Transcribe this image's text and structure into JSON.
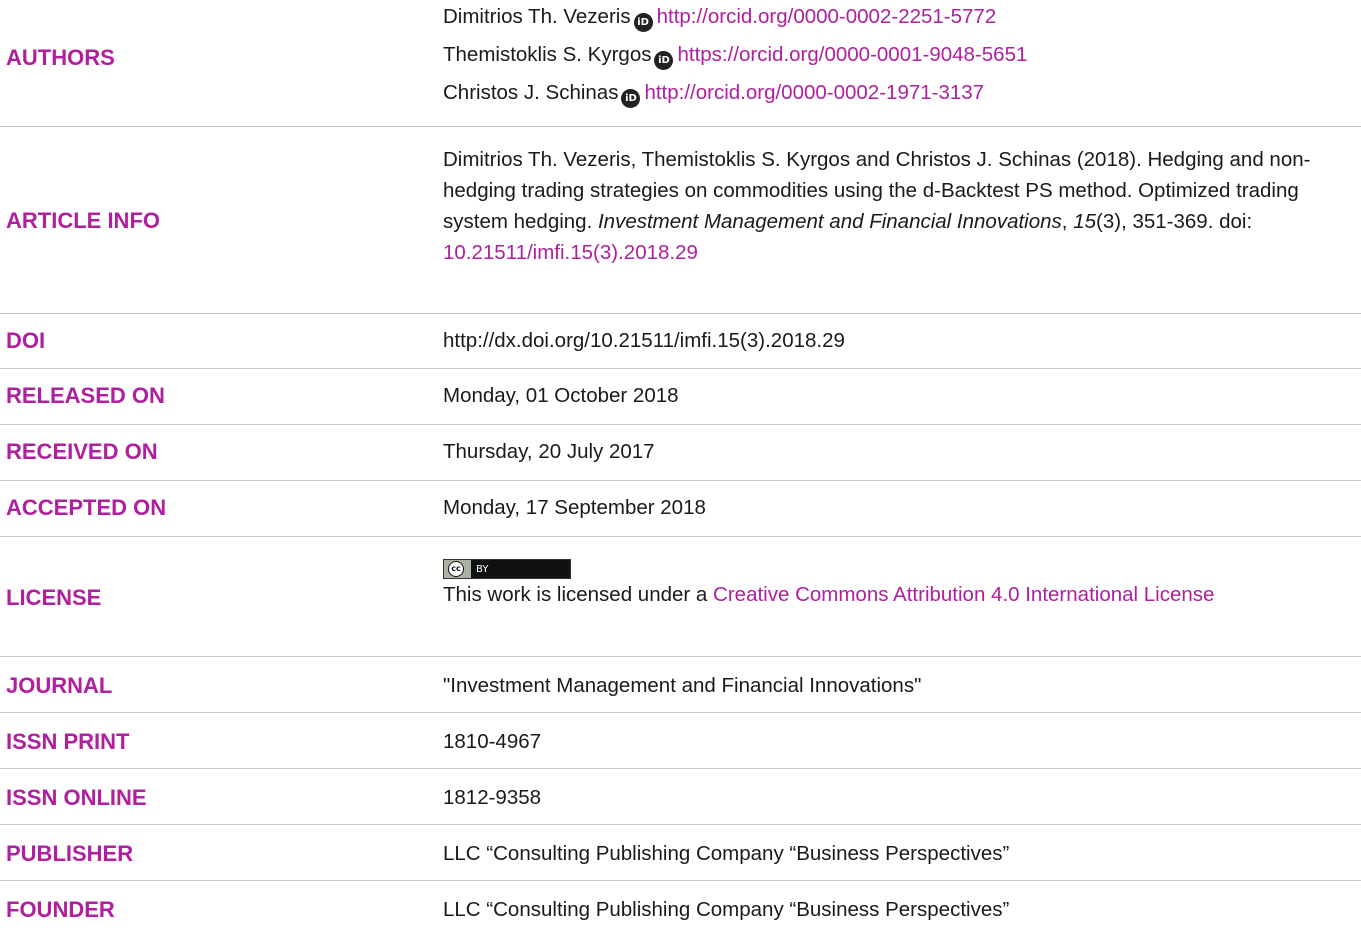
{
  "authors": {
    "label": "AUTHORS",
    "list": [
      {
        "name": "Dimitrios Th. Vezeris",
        "orcid_url": "http://orcid.org/0000-0002-2251-5772"
      },
      {
        "name": "Themistoklis S. Kyrgos",
        "orcid_url": "https://orcid.org/0000-0001-9048-5651"
      },
      {
        "name": "Christos J. Schinas",
        "orcid_url": "http://orcid.org/0000-0002-1971-3137"
      }
    ]
  },
  "article_info": {
    "label": "ARTICLE INFO",
    "citation_authors": "Dimitrios Th. Vezeris, Themistoklis S. Kyrgos and Christos J. Schinas (2018). Hedging and non-hedging trading strategies on commodities using the d-Backtest PS method. Optimized trading system hedging. ",
    "journal_italic": "Investment Management and Financial Innovations",
    "sep1": ", ",
    "volume_italic": "15",
    "issue_pages": "(3), 351-369. doi:",
    "doi_link": "10.21511/imfi.15(3).2018.29"
  },
  "doi": {
    "label": "DOI",
    "value": "http://dx.doi.org/10.21511/imfi.15(3).2018.29"
  },
  "released_on": {
    "label": "RELEASED ON",
    "value": "Monday, 01 October 2018"
  },
  "received_on": {
    "label": "RECEIVED ON",
    "value": "Thursday, 20 July 2017"
  },
  "accepted_on": {
    "label": "ACCEPTED ON",
    "value": "Monday, 17 September 2018"
  },
  "license": {
    "label": "LICENSE",
    "badge_left": "cc",
    "badge_right": "BY",
    "text_prefix": "This work is licensed under a ",
    "link_text": "Creative Commons Attribution 4.0 International License"
  },
  "journal": {
    "label": "JOURNAL",
    "value": "\"Investment Management and Financial Innovations\""
  },
  "issn_print": {
    "label": "ISSN PRINT",
    "value": "1810-4967"
  },
  "issn_online": {
    "label": "ISSN ONLINE",
    "value": "1812-9358"
  },
  "publisher": {
    "label": "PUBLISHER",
    "value": "LLC “Consulting Publishing Company “Business Perspectives”"
  },
  "founder": {
    "label": "FOUNDER",
    "value": "LLC “Consulting Publishing Company “Business Perspectives”"
  },
  "colors": {
    "accent": "#b0209e",
    "text": "#1a1a1a",
    "divider": "#c9c9c9"
  }
}
